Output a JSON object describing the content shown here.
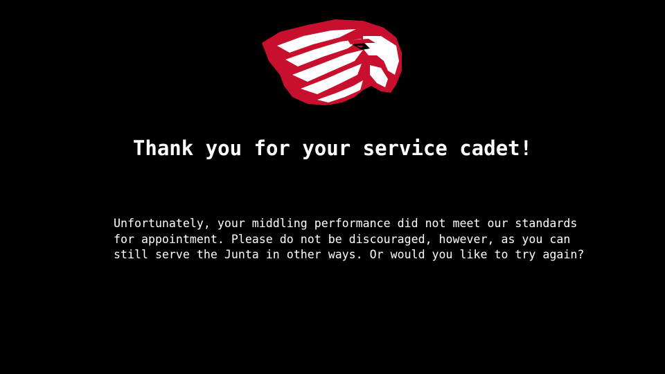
{
  "title": "Thank you for your service cadet!",
  "message_lines": [
    "Unfortunately, your middling performance did not meet our standards",
    "for appointment. Please do not be discouraged, however, as you can",
    "still serve the Junta in other ways. Or would you like to try again?"
  ],
  "logo": {
    "icon": "eagle-head-icon",
    "colors": {
      "primary": "#c8102e",
      "secondary": "#ffffff",
      "outline": "#000000"
    }
  },
  "colors": {
    "background": "#000000",
    "text": "#ffffff"
  }
}
